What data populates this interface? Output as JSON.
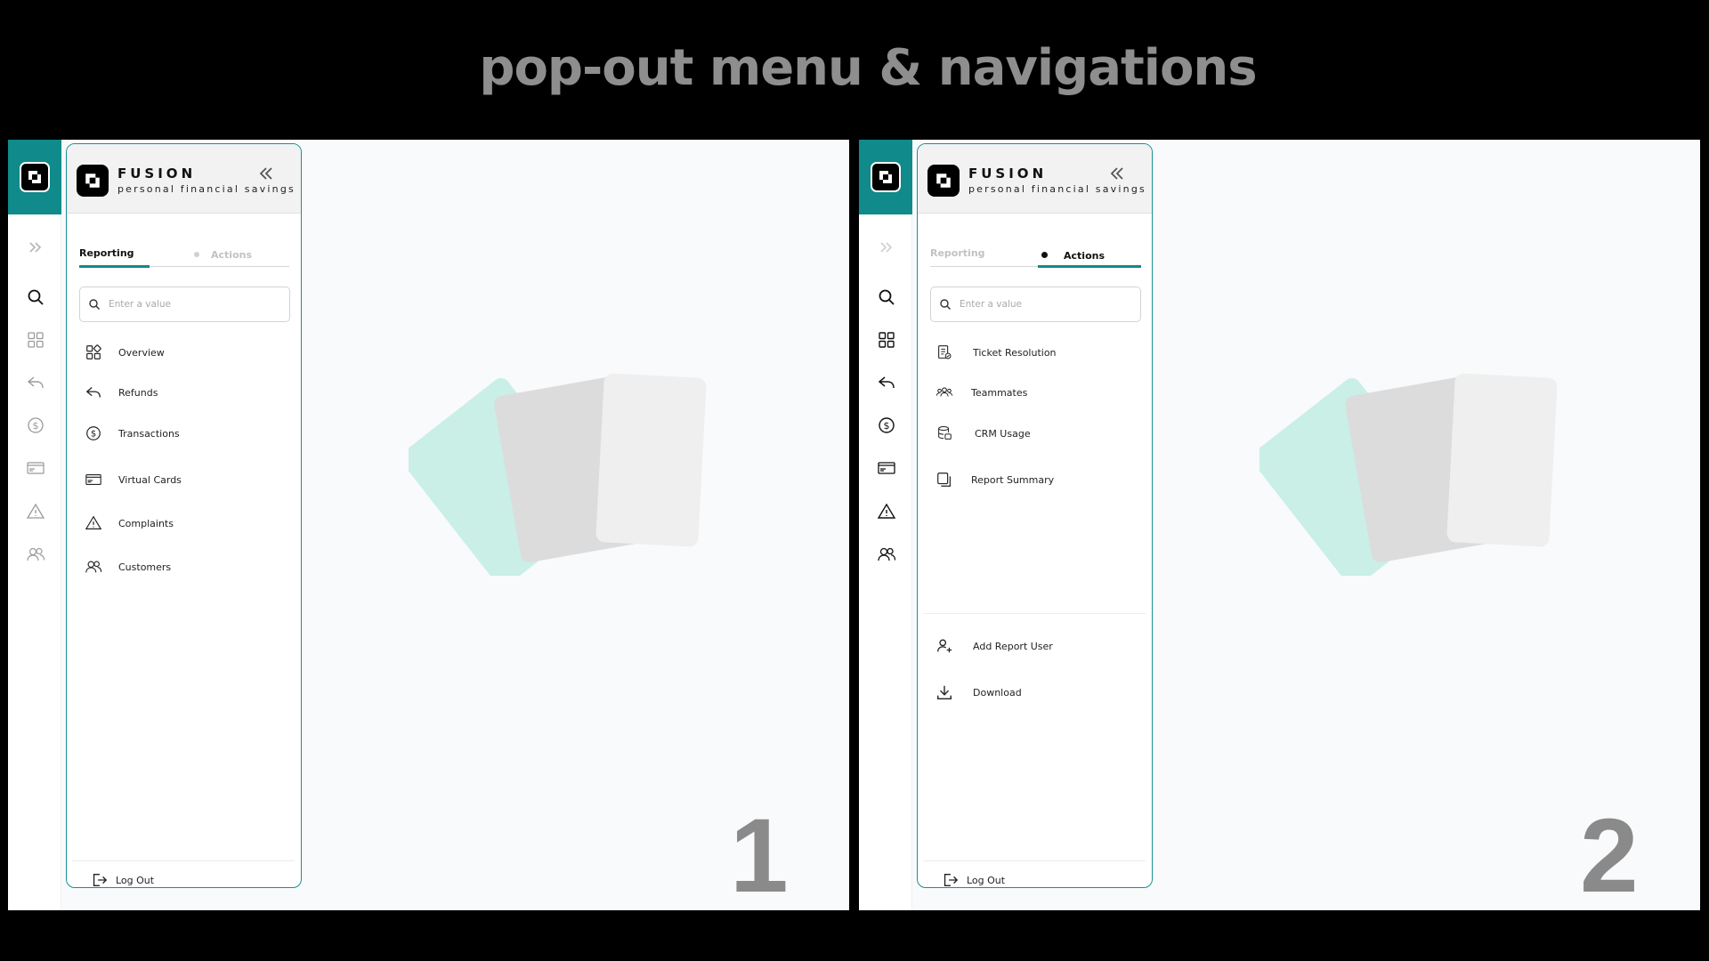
{
  "headline": "pop-out menu & navigations",
  "brand": {
    "name": "FUSION",
    "tagline": "personal financial savings"
  },
  "colors": {
    "accent": "#108a8a",
    "panel_border": "#1b8f92"
  },
  "screen1": {
    "number": "1",
    "tabs": {
      "reporting": "Reporting",
      "actions": "Actions",
      "active": "reporting"
    },
    "search": {
      "placeholder": "Enter a value"
    },
    "items": [
      {
        "label": "Overview",
        "icon": "grid-icon"
      },
      {
        "label": "Refunds",
        "icon": "reply-icon"
      },
      {
        "label": "Transactions",
        "icon": "dollar-circle-icon"
      },
      {
        "label": "Virtual Cards",
        "icon": "card-icon"
      },
      {
        "label": "Complaints",
        "icon": "warning-icon"
      },
      {
        "label": "Customers",
        "icon": "users-icon"
      }
    ],
    "logout": "Log Out"
  },
  "screen2": {
    "number": "2",
    "tabs": {
      "reporting": "Reporting",
      "actions": "Actions",
      "active": "actions"
    },
    "search": {
      "placeholder": "Enter a value"
    },
    "items": [
      {
        "label": "Ticket Resolution",
        "icon": "ticket-icon"
      },
      {
        "label": "Teammates",
        "icon": "team-icon"
      },
      {
        "label": "CRM Usage",
        "icon": "database-icon"
      },
      {
        "label": "Report Summary",
        "icon": "copy-icon"
      }
    ],
    "lower_items": [
      {
        "label": "Add Report User",
        "icon": "user-plus-icon"
      },
      {
        "label": "Download",
        "icon": "download-icon"
      }
    ],
    "logout": "Log Out"
  }
}
